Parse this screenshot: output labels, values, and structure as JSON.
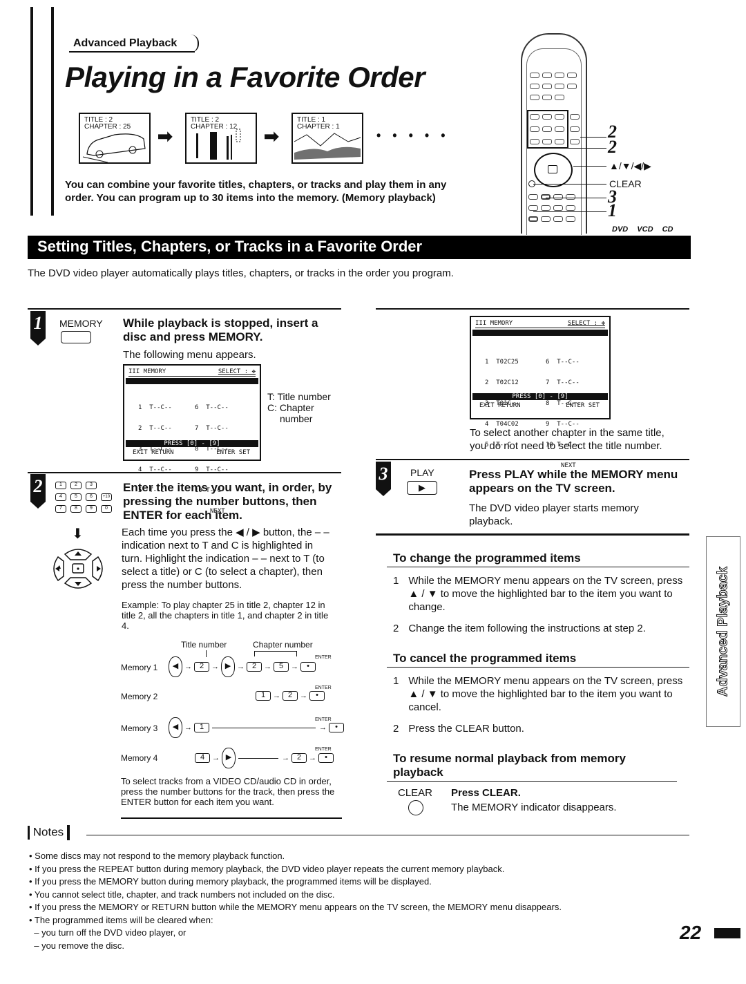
{
  "header": {
    "section_tag": "Advanced Playback",
    "page_title": "Playing in a Favorite Order"
  },
  "screens": [
    {
      "title_line": "TITLE : 2",
      "chapter_line": "CHAPTER : 25"
    },
    {
      "title_line": "TITLE : 2",
      "chapter_line": "CHAPTER : 12"
    },
    {
      "title_line": "TITLE : 1",
      "chapter_line": "CHAPTER : 1"
    }
  ],
  "sequence": {
    "arrow": "➡",
    "ellipsis": "• • • • •"
  },
  "intro": "You can combine your favorite titles, chapters, or tracks and play them in any order. You can program up to 30 items into the memory. (Memory playback)",
  "remote": {
    "callouts": [
      {
        "label": "2"
      },
      {
        "label": "2"
      },
      {
        "label": "▲/▼/◀/▶"
      },
      {
        "label": "CLEAR"
      },
      {
        "label": "3"
      },
      {
        "label": "1"
      }
    ]
  },
  "banner": {
    "title": "Setting Titles, Chapters, or Tracks in a Favorite Order",
    "disc_tags": [
      "DVD",
      "VCD",
      "CD"
    ]
  },
  "subtitle": "The DVD video player automatically plays titles, chapters, or tracks in the order you program.",
  "step1": {
    "number": "1",
    "button_label": "MEMORY",
    "heading": "While playback is stopped, insert a disc and press MEMORY.",
    "text": "The following menu appears.",
    "legend": {
      "t": "T: Title number",
      "c": "C: Chapter",
      "c2": "number"
    }
  },
  "osd1": {
    "header_left": "III  MEMORY",
    "header_right": "SELECT : ✥",
    "left_rows": [
      "1  T--C--",
      "2  T--C--",
      "3  T--C--",
      "4  T--C--",
      "5  T--C--"
    ],
    "right_rows": [
      "6  T--C--",
      "7  T--C--",
      "8  T--C--",
      "9  T--C--",
      "10 T--C--"
    ],
    "next": "NEXT",
    "press": "PRESS  [0] - [9]",
    "exit": "EXIT RETURN",
    "set": "ENTER SET"
  },
  "osd2": {
    "header_left": "III  MEMORY",
    "header_right": "SELECT : ✥",
    "left_rows": [
      "1  T02C25",
      "2  T02C12",
      "3  T01C--",
      "4  T04C02",
      "5  T--C  "
    ],
    "right_rows": [
      "6  T--C--",
      "7  T--C--",
      "8  T--C--",
      "9  T--C--",
      "10 T--C--"
    ],
    "next": "NEXT",
    "press": "PRESS  [0] - [9]",
    "exit": "EXIT RETURN",
    "set": "ENTER SET",
    "caption": "To select another chapter in the same title, you do not need to select the title number."
  },
  "step2": {
    "number": "2",
    "heading": "Enter the items you want, in order, by pressing the number buttons, then ENTER for each item.",
    "keypad": [
      "1",
      "2",
      "3",
      "4",
      "5",
      "6",
      "+10",
      "7",
      "8",
      "9",
      "0"
    ],
    "text": "Each time you press the ◀ / ▶ button, the – – indication next to T and C is highlighted in turn. Highlight the indication – – next to T (to select a title) or C (to select a chapter), then press the number buttons.",
    "example": "Example: To play chapter 25 in title 2, chapter 12 in title 2, all the chapters in title 1, and chapter 2 in title 4.",
    "title_number_label": "Title number",
    "chapter_number_label": "Chapter number",
    "enter_label": "ENTER",
    "memories": [
      {
        "label": "Memory 1",
        "keys": [
          "◀",
          "2",
          "▶",
          "2",
          "5",
          "•"
        ]
      },
      {
        "label": "Memory 2",
        "keys": [
          "1",
          "2",
          "•"
        ]
      },
      {
        "label": "Memory 3",
        "keys": [
          "◀",
          "1",
          "•"
        ]
      },
      {
        "label": "Memory 4",
        "keys": [
          "4",
          "▶",
          "2",
          "•"
        ]
      }
    ],
    "vcd_note": "To select tracks from a VIDEO CD/audio CD in order, press the number buttons for the track, then press the ENTER button for each item you want."
  },
  "step3": {
    "number": "3",
    "button_label": "PLAY",
    "heading": "Press PLAY while the MEMORY menu appears on the TV screen.",
    "text": "The DVD video player starts memory playback."
  },
  "change": {
    "heading": "To change the programmed items",
    "items": [
      "While the MEMORY menu appears on the TV screen, press ▲ / ▼ to move the highlighted bar to the item you want to change.",
      "Change the item following the instructions at step 2."
    ]
  },
  "cancel": {
    "heading": "To cancel the programmed items",
    "items": [
      "While the MEMORY menu appears on the TV screen, press ▲ / ▼ to move the highlighted bar to the item you want to cancel.",
      "Press the CLEAR button."
    ]
  },
  "resume": {
    "heading": "To resume normal playback from memory playback",
    "button_label": "CLEAR",
    "action": "Press CLEAR.",
    "text": "The MEMORY indicator disappears."
  },
  "notes": {
    "title": "Notes",
    "items": [
      "• Some discs may not respond to the memory playback function.",
      "• If you press the REPEAT button during memory playback, the DVD video player repeats the current memory playback.",
      "• If you press the MEMORY button during memory playback, the programmed items will be displayed.",
      "• You cannot select title, chapter, and track numbers not included on the disc.",
      "• If you press the MEMORY or RETURN button while the MEMORY menu appears on the TV screen, the MEMORY menu disappears.",
      "• The programmed items will be cleared when:",
      "  – you turn off the DVD video player, or",
      "  – you remove the disc."
    ]
  },
  "side_tab": "Advanced Playback",
  "page_number": "22"
}
